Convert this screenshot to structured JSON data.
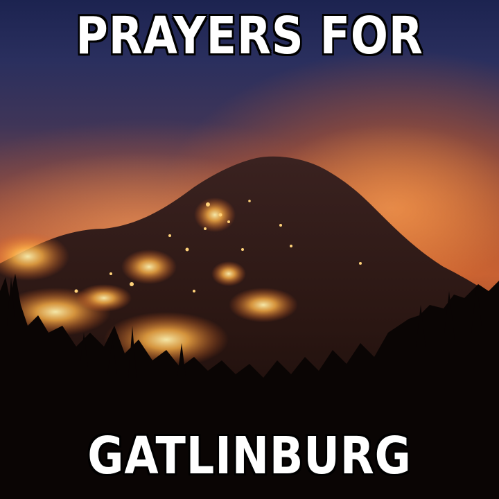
{
  "meme": {
    "top_text": "PRAYERS FOR",
    "bottom_text": "GATLINBURG"
  },
  "colors": {
    "sky_top": "#1c2350",
    "glow": "#e0783a",
    "fire": "#ffb347",
    "silhouette": "#0a0504",
    "caption": "#ffffff",
    "caption_outline": "#000000"
  }
}
